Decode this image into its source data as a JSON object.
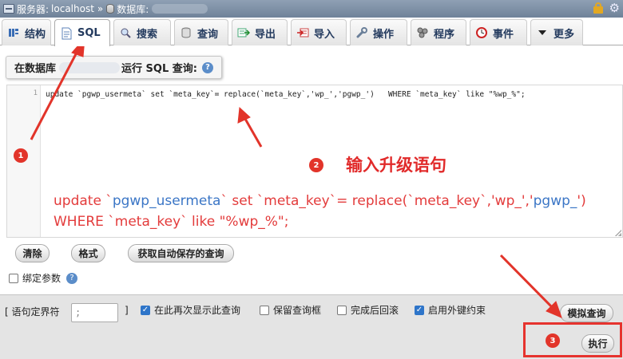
{
  "breadcrumb": {
    "server_label": "服务器:",
    "server_name": "localhost",
    "separator": "»",
    "database_label": "数据库:"
  },
  "tabs": [
    {
      "label": "结构",
      "icon": "structure-icon"
    },
    {
      "label": "SQL",
      "icon": "sql-icon",
      "active": true
    },
    {
      "label": "搜索",
      "icon": "search-icon"
    },
    {
      "label": "查询",
      "icon": "query-icon"
    },
    {
      "label": "导出",
      "icon": "export-icon"
    },
    {
      "label": "导入",
      "icon": "import-icon"
    },
    {
      "label": "操作",
      "icon": "wrench-icon"
    },
    {
      "label": "程序",
      "icon": "routines-icon"
    },
    {
      "label": "事件",
      "icon": "clock-icon"
    },
    {
      "label": "更多",
      "icon": "caret-down-icon"
    }
  ],
  "sql_box": {
    "prefix": "在数据库",
    "suffix": "运行 SQL 查询:"
  },
  "editor": {
    "line_number": "1",
    "code": "update `pgwp_usermeta` set `meta_key`= replace(`meta_key`,'wp_','pgwp_')   WHERE `meta_key` like \"%wp_%\";"
  },
  "annotations": {
    "step1": "1",
    "step2": "2",
    "step3": "3",
    "title": "输入升级语句",
    "code_line1_part1": "update `",
    "code_line1_part2": "pgwp_usermeta",
    "code_line1_part3": "` set `meta_key`= replace(`meta_key`,'wp_','",
    "code_line1_part4": "pgwp_",
    "code_line1_part5": "')",
    "code_line2": "WHERE `meta_key` like \"%wp_%\";",
    "accent_color": "#e2342a"
  },
  "buttons": {
    "clear": "清除",
    "format": "格式",
    "autosaved": "获取自动保存的查询",
    "simulate": "模拟查询",
    "execute": "执行"
  },
  "bind_params": {
    "label": "绑定参数",
    "checked": false
  },
  "options": {
    "delimiter_label": "[ 语句定界符",
    "delimiter_value": ";",
    "delimiter_end": "]",
    "show_again": {
      "label": "在此再次显示此查询",
      "checked": true
    },
    "retain_box": {
      "label": "保留查询框",
      "checked": false
    },
    "rollback": {
      "label": "完成后回滚",
      "checked": false
    },
    "foreign_keys": {
      "label": "启用外键约束",
      "checked": true
    }
  }
}
